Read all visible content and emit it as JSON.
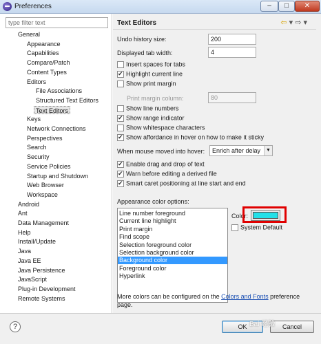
{
  "window": {
    "title": "Preferences"
  },
  "filter": {
    "placeholder": "type filter text"
  },
  "tree": {
    "items": [
      {
        "label": "General"
      },
      {
        "label": "Appearance"
      },
      {
        "label": "Capabilities"
      },
      {
        "label": "Compare/Patch"
      },
      {
        "label": "Content Types"
      },
      {
        "label": "Editors"
      },
      {
        "label": "File Associations"
      },
      {
        "label": "Structured Text Editors"
      },
      {
        "label": "Text Editors",
        "selected": true
      },
      {
        "label": "Keys"
      },
      {
        "label": "Network Connections"
      },
      {
        "label": "Perspectives"
      },
      {
        "label": "Search"
      },
      {
        "label": "Security"
      },
      {
        "label": "Service Policies"
      },
      {
        "label": "Startup and Shutdown"
      },
      {
        "label": "Web Browser"
      },
      {
        "label": "Workspace"
      },
      {
        "label": "Android"
      },
      {
        "label": "Ant"
      },
      {
        "label": "Data Management"
      },
      {
        "label": "Help"
      },
      {
        "label": "Install/Update"
      },
      {
        "label": "Java"
      },
      {
        "label": "Java EE"
      },
      {
        "label": "Java Persistence"
      },
      {
        "label": "JavaScript"
      },
      {
        "label": "Plug-in Development"
      },
      {
        "label": "Remote Systems"
      }
    ]
  },
  "page": {
    "title": "Text Editors",
    "undo_label": "Undo history size:",
    "undo_value": "200",
    "tab_label": "Displayed tab width:",
    "tab_value": "4",
    "checkboxes_a": [
      {
        "label": "Insert spaces for tabs",
        "checked": false
      },
      {
        "label": "Highlight current line",
        "checked": true
      },
      {
        "label": "Show print margin",
        "checked": false
      }
    ],
    "print_margin_label": "Print margin column:",
    "print_margin_value": "80",
    "checkboxes_b": [
      {
        "label": "Show line numbers",
        "checked": false
      },
      {
        "label": "Show range indicator",
        "checked": true
      },
      {
        "label": "Show whitespace characters",
        "checked": false
      },
      {
        "label": "Show affordance in hover on how to make it sticky",
        "checked": true
      }
    ],
    "hover_label": "When mouse moved into hover:",
    "hover_value": "Enrich after delay",
    "checkboxes_c": [
      {
        "label": "Enable drag and drop of text",
        "checked": true
      },
      {
        "label": "Warn before editing a derived file",
        "checked": true
      },
      {
        "label": "Smart caret positioning at line start and end",
        "checked": true
      }
    ],
    "appearance_label": "Appearance color options:",
    "color_options": [
      "Line number foreground",
      "Current line highlight",
      "Print margin",
      "Find scope",
      "Selection foreground color",
      "Selection background color",
      "Background color",
      "Foreground color",
      "Hyperlink"
    ],
    "selected_color_option": "Background color",
    "color_label": "Color:",
    "color_value": "#22e0e8",
    "system_default_label": "System Default",
    "more_text_prefix": "More colors can be configured on the ",
    "more_link": "Colors and Fonts",
    "more_text_suffix": " preference page."
  },
  "footer": {
    "help": "?",
    "ok": "OK",
    "cancel": "Cancel"
  },
  "watermark": "Bai 经验"
}
